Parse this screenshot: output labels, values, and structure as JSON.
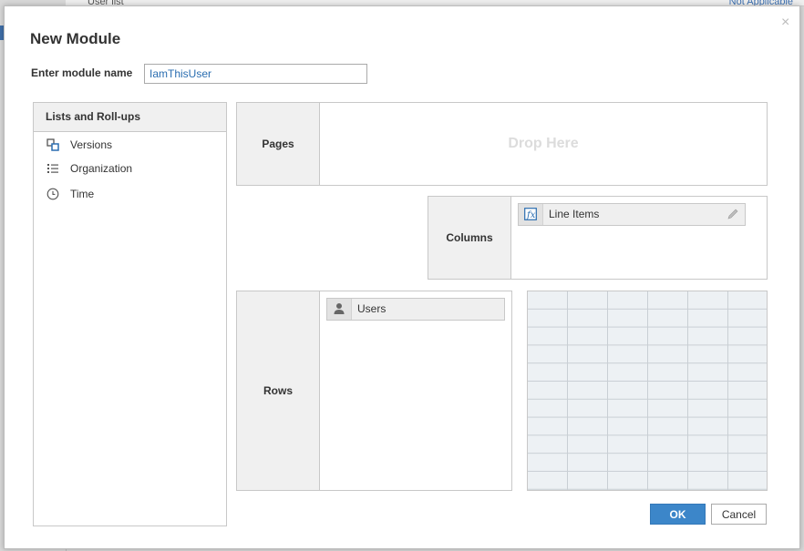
{
  "background": {
    "left_text": "User list",
    "right_text": "Not Applicable"
  },
  "dialog": {
    "title": "New Module",
    "close_glyph": "×",
    "name_label": "Enter module name",
    "name_value": "IamThisUser"
  },
  "lists": {
    "header": "Lists and Roll-ups",
    "items": [
      {
        "label": "Versions",
        "icon": "versions-icon"
      },
      {
        "label": "Organization",
        "icon": "list-icon"
      },
      {
        "label": "Time",
        "icon": "clock-icon"
      }
    ]
  },
  "zones": {
    "pages": {
      "label": "Pages",
      "placeholder": "Drop Here"
    },
    "columns": {
      "label": "Columns",
      "chip": {
        "label": "Line Items",
        "icon": "function-icon"
      }
    },
    "rows": {
      "label": "Rows",
      "chip": {
        "label": "Users",
        "icon": "user-icon"
      }
    }
  },
  "buttons": {
    "ok": "OK",
    "cancel": "Cancel"
  },
  "colors": {
    "accent": "#3c86c9",
    "link": "#2a6db0",
    "panel_header": "#f0f0f0"
  }
}
